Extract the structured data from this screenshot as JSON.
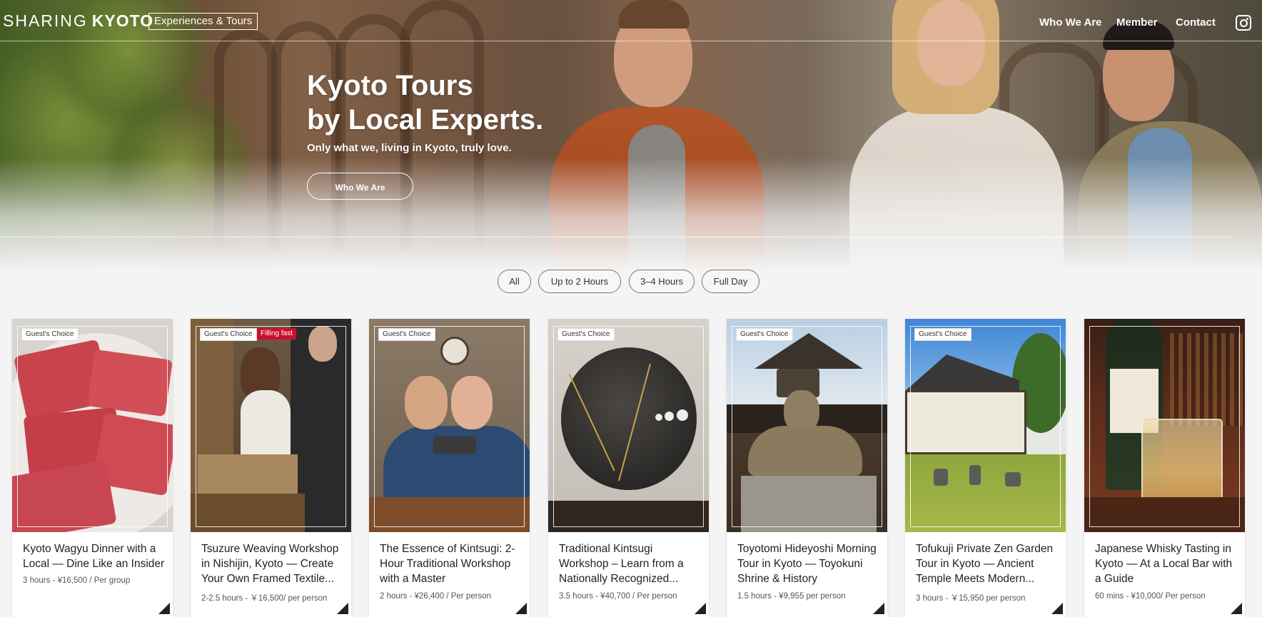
{
  "header": {
    "logo_thin": "SHARING",
    "logo_bold": "KYOTO",
    "logo_tag": "Experiences & Tours",
    "nav": [
      "Who We Are",
      "Member",
      "Contact"
    ],
    "social_icon": "instagram-icon"
  },
  "hero": {
    "title_line1": "Kyoto Tours",
    "title_line2": "by Local Experts.",
    "subtitle": "Only what we, living in Kyoto, truly love.",
    "cta_label": "Who We Are"
  },
  "filters": [
    "All",
    "Up to 2 Hours",
    "3–4 Hours",
    "Full Day"
  ],
  "colors": {
    "accent_red": "#c8102e",
    "text_dark": "#222222",
    "background": "#f4f4f4"
  },
  "cards": [
    {
      "badges": [
        "Guest's Choice"
      ],
      "title": "Kyoto Wagyu Dinner with a Local — Dine Like an Insider",
      "meta": "3 hours - ¥16,500 / Per group"
    },
    {
      "badges": [
        "Guest's Choice",
        "Filling fast"
      ],
      "title": "Tsuzure Weaving Workshop in Nishijin, Kyoto — Create Your Own Framed Textile...",
      "meta": "2-2.5 hours - ￥16,500/ per person"
    },
    {
      "badges": [
        "Guest's Choice"
      ],
      "title": "The Essence of Kintsugi: 2-Hour Traditional Workshop with a Master",
      "meta": "2 hours - ¥26,400 / Per person"
    },
    {
      "badges": [
        "Guest's Choice"
      ],
      "title": "Traditional Kintsugi Workshop – Learn from a Nationally Recognized...",
      "meta": "3.5 hours - ¥40,700 / Per person"
    },
    {
      "badges": [
        "Guest's Choice"
      ],
      "title": "Toyotomi Hideyoshi Morning Tour in Kyoto — Toyokuni Shrine & History",
      "meta": "1.5 hours - ¥9,955 per person"
    },
    {
      "badges": [
        "Guest's Choice"
      ],
      "title": "Tofukuji Private Zen Garden Tour in Kyoto — Ancient Temple Meets Modern...",
      "meta": "3 hours - ￥15,950 per person"
    },
    {
      "badges": [],
      "title": "Japanese Whisky Tasting in Kyoto — At a Local Bar with a Guide",
      "meta": "60 mins - ¥10,000/ Per person"
    }
  ]
}
